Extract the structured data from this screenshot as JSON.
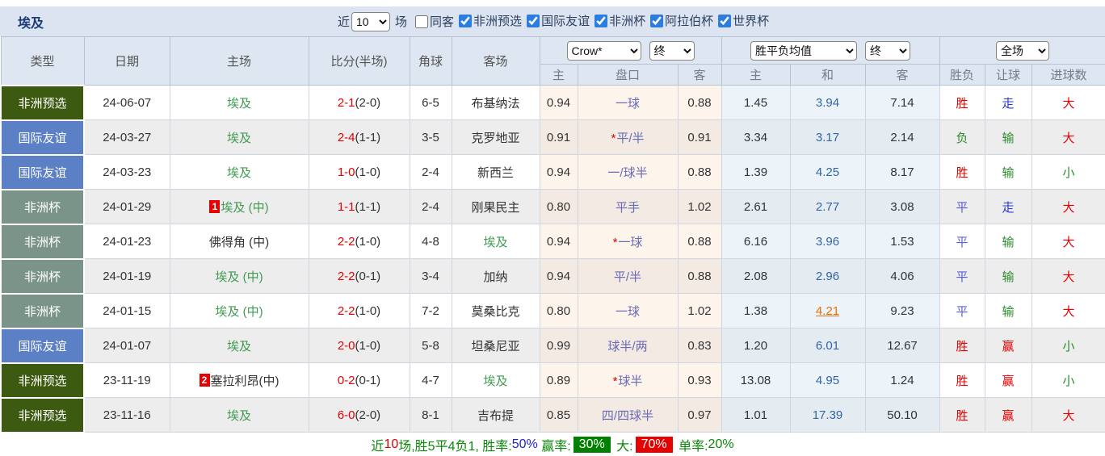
{
  "title": "埃及",
  "filter": {
    "recent": {
      "prefix": "近",
      "value": "10",
      "suffix": "场"
    },
    "same_away": {
      "label": "同客",
      "checked": false
    },
    "competitions": [
      {
        "label": "非洲预选",
        "checked": true
      },
      {
        "label": "国际友谊",
        "checked": true
      },
      {
        "label": "非洲杯",
        "checked": true
      },
      {
        "label": "阿拉伯杯",
        "checked": true
      },
      {
        "label": "世界杯",
        "checked": true
      }
    ]
  },
  "table": {
    "main_headers": [
      "类型",
      "日期",
      "主场",
      "比分(半场)",
      "角球",
      "客场"
    ],
    "subheaders": [
      "主",
      "盘口",
      "客",
      "主",
      "和",
      "客",
      "胜负",
      "让球",
      "进球数"
    ],
    "selects": {
      "bookmaker": "Crow*",
      "ah_time": "终",
      "euro_mode": "胜平负均值",
      "euro_time": "终",
      "scope": "全场"
    },
    "type_colors": {
      "非洲预选": "#3d5a11",
      "国际友谊": "#5b80c6",
      "非洲杯": "#7b9489"
    },
    "rows": [
      {
        "type": "非洲预选",
        "date": "24-06-07",
        "home": {
          "name": "埃及",
          "egypt": true
        },
        "score": [
          "2-1",
          "(2-0)"
        ],
        "corner": "6-5",
        "away": {
          "name": "布基纳法",
          "egypt": false
        },
        "star": false,
        "ah": [
          "0.94",
          "一球",
          "0.88"
        ],
        "euro": [
          "1.45",
          "3.94",
          "7.14"
        ],
        "hl": false,
        "res": [
          "胜",
          "r"
        ],
        "let": [
          "走",
          "b"
        ],
        "goal": [
          "大",
          "r"
        ]
      },
      {
        "type": "国际友谊",
        "date": "24-03-27",
        "home": {
          "name": "埃及",
          "egypt": true
        },
        "score": [
          "2-4",
          "(1-1)"
        ],
        "corner": "3-5",
        "away": {
          "name": "克罗地亚",
          "egypt": false
        },
        "star": true,
        "ah": [
          "0.91",
          "平/半",
          "0.91"
        ],
        "euro": [
          "3.34",
          "3.17",
          "2.14"
        ],
        "hl": false,
        "res": [
          "负",
          "g"
        ],
        "let": [
          "输",
          "g"
        ],
        "goal": [
          "大",
          "r"
        ]
      },
      {
        "type": "国际友谊",
        "date": "24-03-23",
        "home": {
          "name": "埃及",
          "egypt": true
        },
        "score": [
          "1-0",
          "(1-0)"
        ],
        "corner": "2-4",
        "away": {
          "name": "新西兰",
          "egypt": false
        },
        "star": false,
        "ah": [
          "0.94",
          "一/球半",
          "0.88"
        ],
        "euro": [
          "1.39",
          "4.25",
          "8.17"
        ],
        "hl": false,
        "res": [
          "胜",
          "r"
        ],
        "let": [
          "输",
          "g"
        ],
        "goal": [
          "小",
          "g"
        ]
      },
      {
        "type": "非洲杯",
        "date": "24-01-29",
        "home": {
          "name": "埃及 (中)",
          "egypt": true,
          "mark": "1"
        },
        "score": [
          "1-1",
          "(1-1)"
        ],
        "corner": "2-4",
        "away": {
          "name": "刚果民主",
          "egypt": false
        },
        "star": false,
        "ah": [
          "0.80",
          "平手",
          "1.02"
        ],
        "euro": [
          "2.61",
          "2.77",
          "3.08"
        ],
        "hl": false,
        "res": [
          "平",
          "p"
        ],
        "let": [
          "走",
          "b"
        ],
        "goal": [
          "大",
          "r"
        ]
      },
      {
        "type": "非洲杯",
        "date": "24-01-23",
        "home": {
          "name": "佛得角 (中)",
          "egypt": false
        },
        "score": [
          "2-2",
          "(1-0)"
        ],
        "corner": "4-8",
        "away": {
          "name": "埃及",
          "egypt": true
        },
        "star": true,
        "ah": [
          "0.94",
          "一球",
          "0.88"
        ],
        "euro": [
          "6.16",
          "3.96",
          "1.53"
        ],
        "hl": false,
        "res": [
          "平",
          "p"
        ],
        "let": [
          "输",
          "g"
        ],
        "goal": [
          "大",
          "r"
        ]
      },
      {
        "type": "非洲杯",
        "date": "24-01-19",
        "home": {
          "name": "埃及 (中)",
          "egypt": true
        },
        "score": [
          "2-2",
          "(0-1)"
        ],
        "corner": "3-4",
        "away": {
          "name": "加纳",
          "egypt": false
        },
        "star": false,
        "ah": [
          "0.94",
          "平/半",
          "0.88"
        ],
        "euro": [
          "2.08",
          "2.96",
          "4.06"
        ],
        "hl": false,
        "res": [
          "平",
          "p"
        ],
        "let": [
          "输",
          "g"
        ],
        "goal": [
          "大",
          "r"
        ]
      },
      {
        "type": "非洲杯",
        "date": "24-01-15",
        "home": {
          "name": "埃及 (中)",
          "egypt": true
        },
        "score": [
          "2-2",
          "(1-0)"
        ],
        "corner": "7-2",
        "away": {
          "name": "莫桑比克",
          "egypt": false
        },
        "star": false,
        "ah": [
          "0.80",
          "一球",
          "1.02"
        ],
        "euro": [
          "1.38",
          "4.21",
          "9.23"
        ],
        "hl": true,
        "res": [
          "平",
          "p"
        ],
        "let": [
          "输",
          "g"
        ],
        "goal": [
          "大",
          "r"
        ]
      },
      {
        "type": "国际友谊",
        "date": "24-01-07",
        "home": {
          "name": "埃及",
          "egypt": true
        },
        "score": [
          "2-0",
          "(1-0)"
        ],
        "corner": "5-8",
        "away": {
          "name": "坦桑尼亚",
          "egypt": false
        },
        "star": false,
        "ah": [
          "0.99",
          "球半/两",
          "0.83"
        ],
        "euro": [
          "1.20",
          "6.01",
          "12.67"
        ],
        "hl": false,
        "res": [
          "胜",
          "r"
        ],
        "let": [
          "赢",
          "r"
        ],
        "goal": [
          "小",
          "g"
        ]
      },
      {
        "type": "非洲预选",
        "date": "23-11-19",
        "home": {
          "name": "塞拉利昂(中)",
          "egypt": false,
          "mark": "2"
        },
        "score": [
          "0-2",
          "(0-1)"
        ],
        "corner": "4-7",
        "away": {
          "name": "埃及",
          "egypt": true
        },
        "star": true,
        "ah": [
          "0.89",
          "球半",
          "0.93"
        ],
        "euro": [
          "13.08",
          "4.95",
          "1.24"
        ],
        "hl": false,
        "res": [
          "胜",
          "r"
        ],
        "let": [
          "赢",
          "r"
        ],
        "goal": [
          "小",
          "g"
        ]
      },
      {
        "type": "非洲预选",
        "date": "23-11-16",
        "home": {
          "name": "埃及",
          "egypt": true
        },
        "score": [
          "6-0",
          "(2-0)"
        ],
        "corner": "8-1",
        "away": {
          "name": "吉布提",
          "egypt": false
        },
        "star": false,
        "ah": [
          "0.85",
          "四/四球半",
          "0.97"
        ],
        "euro": [
          "1.01",
          "17.39",
          "50.10"
        ],
        "hl": false,
        "res": [
          "胜",
          "r"
        ],
        "let": [
          "赢",
          "r"
        ],
        "goal": [
          "大",
          "r"
        ]
      }
    ]
  },
  "summary": {
    "segments": [
      {
        "t": "近",
        "s": "g"
      },
      {
        "t": "10",
        "s": "r"
      },
      {
        "t": "场,胜5平4负1, ",
        "s": "g"
      },
      {
        "t": "胜率:",
        "s": "g"
      },
      {
        "t": "50%",
        "s": "b"
      },
      {
        "t": " 赢率:",
        "s": "g"
      },
      {
        "t": "30%",
        "s": "bg-green"
      },
      {
        "t": " 大:",
        "s": "g"
      },
      {
        "t": "70%",
        "s": "bg-red"
      },
      {
        "t": " 单率:",
        "s": "g"
      },
      {
        "t": "20%",
        "s": "g"
      }
    ]
  }
}
